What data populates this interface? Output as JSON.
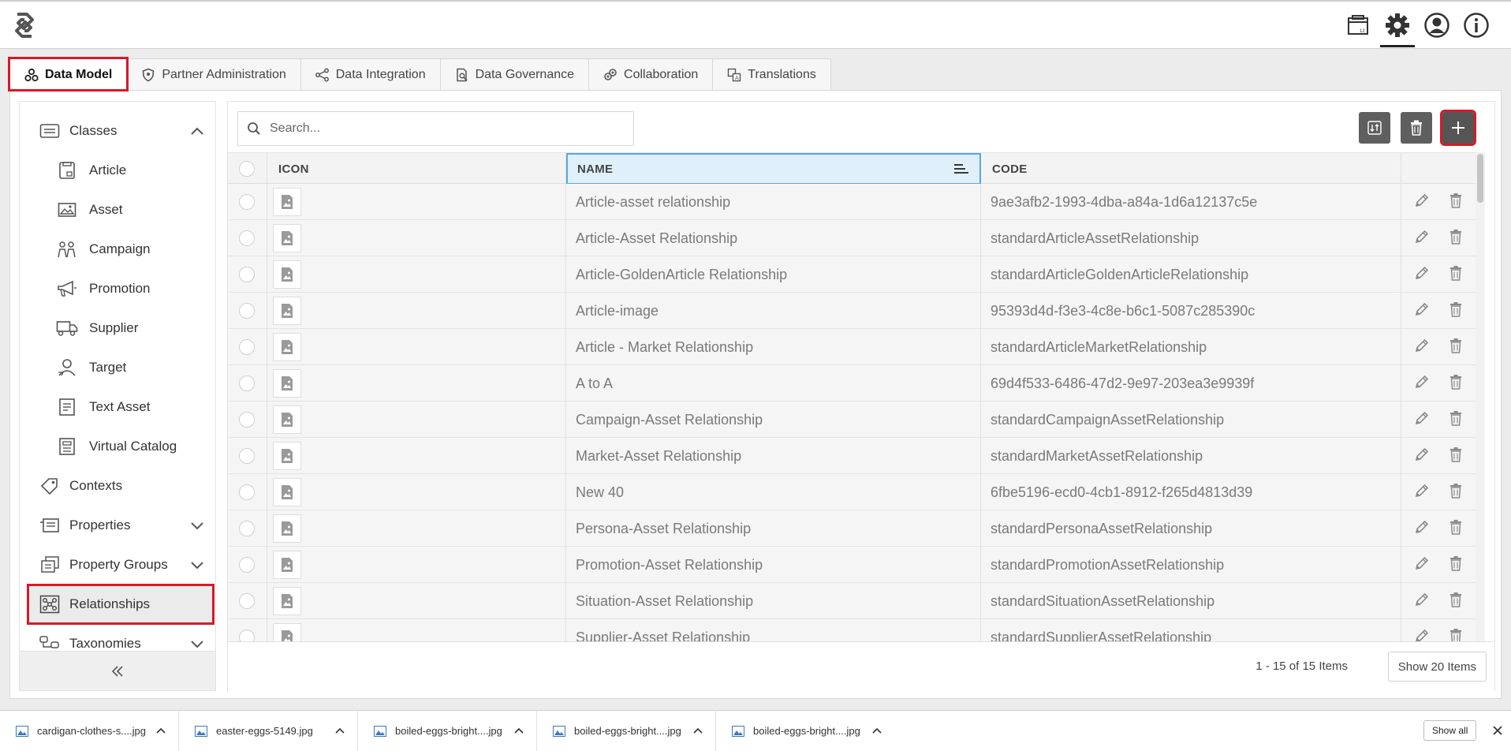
{
  "topbar": {
    "icons": [
      "catalog-icon",
      "gear-icon",
      "user-icon",
      "info-icon"
    ]
  },
  "tabs": [
    {
      "label": "Data Model",
      "icon": "data-model-icon",
      "active": true
    },
    {
      "label": "Partner Administration",
      "icon": "shield-icon"
    },
    {
      "label": "Data Integration",
      "icon": "integration-icon"
    },
    {
      "label": "Data Governance",
      "icon": "governance-icon"
    },
    {
      "label": "Collaboration",
      "icon": "collaboration-icon"
    },
    {
      "label": "Translations",
      "icon": "translations-icon"
    }
  ],
  "sidebar": {
    "items": [
      {
        "label": "Classes",
        "icon": "classes-icon",
        "chevron": "up"
      },
      {
        "label": "Article",
        "icon": "article-icon",
        "child": true
      },
      {
        "label": "Asset",
        "icon": "asset-icon",
        "child": true
      },
      {
        "label": "Campaign",
        "icon": "campaign-icon",
        "child": true
      },
      {
        "label": "Promotion",
        "icon": "megaphone-icon",
        "child": true
      },
      {
        "label": "Supplier",
        "icon": "truck-icon",
        "child": true
      },
      {
        "label": "Target",
        "icon": "target-person-icon",
        "child": true
      },
      {
        "label": "Text Asset",
        "icon": "text-asset-icon",
        "child": true
      },
      {
        "label": "Virtual Catalog",
        "icon": "virtual-catalog-icon",
        "child": true
      },
      {
        "label": "Contexts",
        "icon": "tag-icon"
      },
      {
        "label": "Properties",
        "icon": "properties-icon",
        "chevron": "down"
      },
      {
        "label": "Property Groups",
        "icon": "property-groups-icon",
        "chevron": "down"
      },
      {
        "label": "Relationships",
        "icon": "relationships-icon",
        "selected": true
      },
      {
        "label": "Taxonomies",
        "icon": "taxonomies-icon",
        "chevron": "down"
      }
    ]
  },
  "search": {
    "placeholder": "Search..."
  },
  "table": {
    "columns": [
      "ICON",
      "NAME",
      "CODE"
    ],
    "rows": [
      {
        "name": "Article-asset relationship",
        "code": "9ae3afb2-1993-4dba-a84a-1d6a12137c5e"
      },
      {
        "name": "Article-Asset Relationship",
        "code": "standardArticleAssetRelationship"
      },
      {
        "name": "Article-GoldenArticle Relationship",
        "code": "standardArticleGoldenArticleRelationship"
      },
      {
        "name": "Article-image",
        "code": "95393d4d-f3e3-4c8e-b6c1-5087c285390c"
      },
      {
        "name": "Article - Market Relationship",
        "code": "standardArticleMarketRelationship"
      },
      {
        "name": "A to A",
        "code": "69d4f533-6486-47d2-9e97-203ea3e9939f"
      },
      {
        "name": "Campaign-Asset Relationship",
        "code": "standardCampaignAssetRelationship"
      },
      {
        "name": "Market-Asset Relationship",
        "code": "standardMarketAssetRelationship"
      },
      {
        "name": "New 40",
        "code": "6fbe5196-ecd0-4cb1-8912-f265d4813d39"
      },
      {
        "name": "Persona-Asset Relationship",
        "code": "standardPersonaAssetRelationship"
      },
      {
        "name": "Promotion-Asset Relationship",
        "code": "standardPromotionAssetRelationship"
      },
      {
        "name": "Situation-Asset Relationship",
        "code": "standardSituationAssetRelationship"
      },
      {
        "name": "Supplier-Asset Relationship",
        "code": "standardSupplierAssetRelationship"
      }
    ]
  },
  "pagination": {
    "info": "1 - 15 of 15 Items",
    "show_label": "Show 20 Items"
  },
  "downloads": {
    "files": [
      "cardigan-clothes-s....jpg",
      "easter-eggs-5149.jpg",
      "boiled-eggs-bright....jpg",
      "boiled-eggs-bright....jpg",
      "boiled-eggs-bright....jpg"
    ],
    "show_all": "Show all"
  },
  "colors": {
    "accent_red": "#d7182a",
    "sort_blue": "#5aa8e0",
    "toolbar_gray": "#5f5f5f"
  }
}
